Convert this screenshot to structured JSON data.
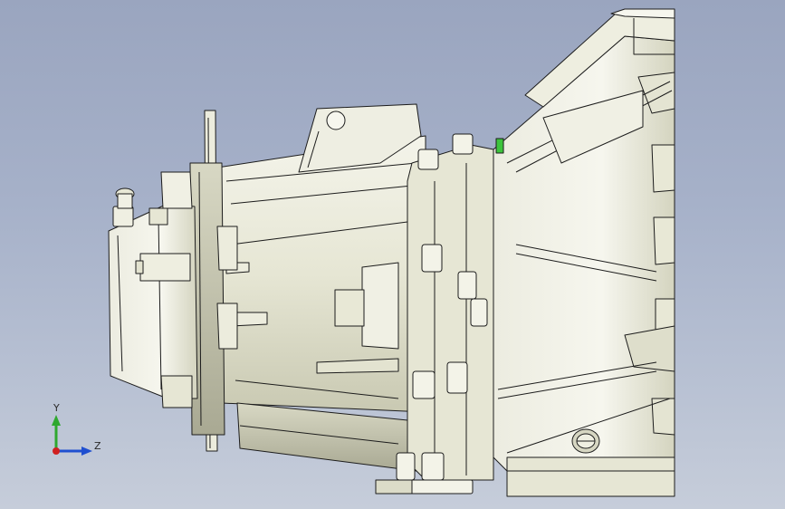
{
  "viewport": {
    "background_top": "#9aa5bf",
    "background_bottom": "#c6cdda"
  },
  "model": {
    "fill_light": "#f2f2e6",
    "fill_mid": "#e1e1cf",
    "fill_shadow": "#bdbda6",
    "edge": "#1c1c1c",
    "accent_green": "#3cc43c"
  },
  "triad": {
    "y_label": "Y",
    "z_label": "Z",
    "y_color": "#2fa82f",
    "z_color": "#1f4fd0",
    "origin_color": "#d02020"
  }
}
